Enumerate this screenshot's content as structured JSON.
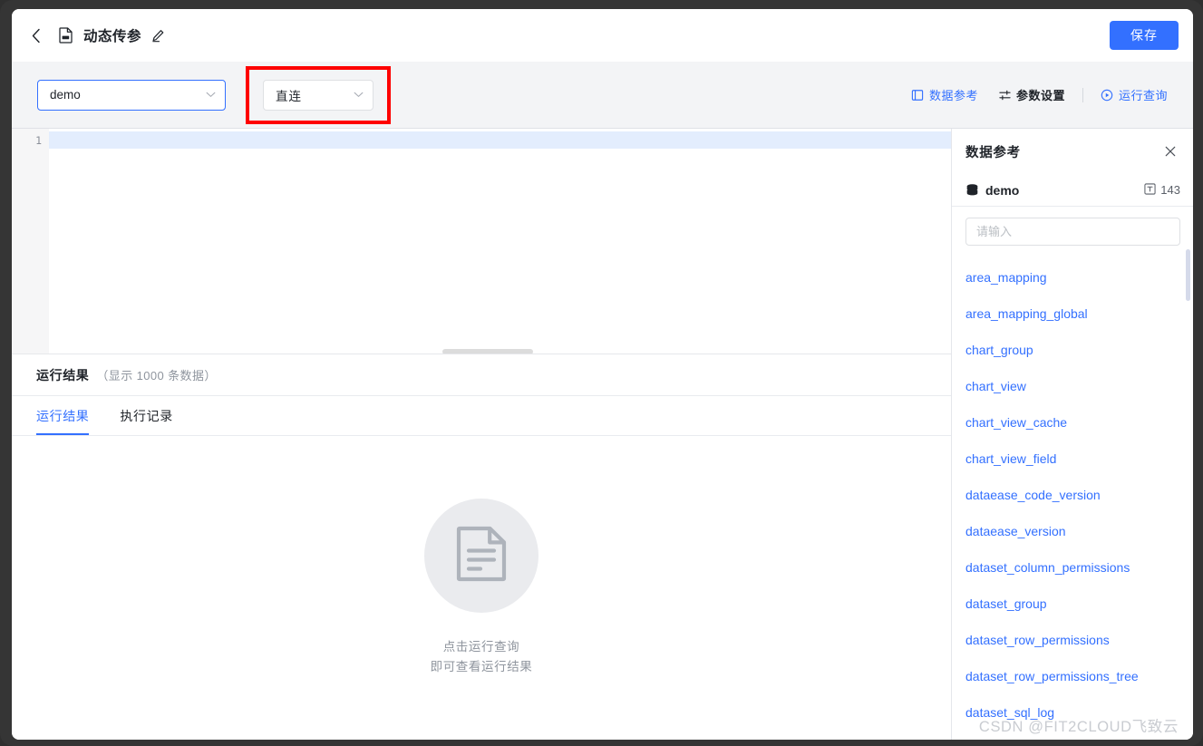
{
  "header": {
    "back_icon": "chevron-left-icon",
    "doc_icon": "sql-document-icon",
    "title": "动态传参",
    "edit_icon": "pencil-edit-icon",
    "save_label": "保存"
  },
  "toolbar": {
    "datasource_value": "demo",
    "mode_value": "直连",
    "actions": [
      {
        "label": "数据参考",
        "icon": "book-reference-icon",
        "style": "blue"
      },
      {
        "label": "参数设置",
        "icon": "sliders-settings-icon",
        "style": "dark"
      },
      {
        "label": "运行查询",
        "icon": "play-circle-icon",
        "style": "blue"
      }
    ],
    "highlight_color": "#fe0000"
  },
  "editor": {
    "line_numbers": [
      "1"
    ],
    "content": ""
  },
  "result": {
    "title": "运行结果",
    "subtitle": "（显示 1000 条数据）",
    "tabs": [
      {
        "label": "运行结果",
        "active": true
      },
      {
        "label": "执行记录",
        "active": false
      }
    ],
    "empty_icon": "document-lines-icon",
    "empty_line1": "点击运行查询",
    "empty_line2": "即可查看运行结果"
  },
  "sidebar": {
    "title": "数据参考",
    "close_icon": "close-icon",
    "datasource_icon": "database-icon",
    "datasource_name": "demo",
    "table_count_icon": "table-text-icon",
    "table_count": "143",
    "search_placeholder": "请输入",
    "search_value": "",
    "tables": [
      "area_mapping",
      "area_mapping_global",
      "chart_group",
      "chart_view",
      "chart_view_cache",
      "chart_view_field",
      "dataease_code_version",
      "dataease_version",
      "dataset_column_permissions",
      "dataset_group",
      "dataset_row_permissions",
      "dataset_row_permissions_tree",
      "dataset_sql_log"
    ]
  },
  "watermark": "CSDN @FIT2CLOUD飞致云",
  "colors": {
    "accent": "#3370ff",
    "toolbar_bg": "#f3f4f6",
    "active_line": "#e3edfd",
    "highlight": "#fe0000"
  }
}
